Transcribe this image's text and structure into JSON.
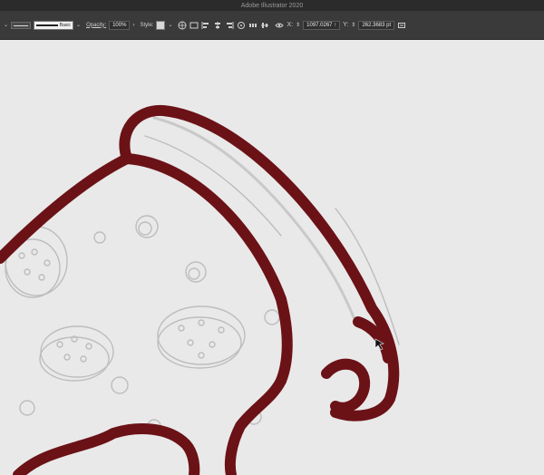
{
  "window": {
    "title": "Adobe Illustrator 2020"
  },
  "control_bar": {
    "stroke_style": "Basic",
    "opacity_label": "Opacity:",
    "opacity_value": "100%",
    "style_label": "Style:",
    "x_label": "X:",
    "x_value": "1097.0267 ↑",
    "y_label": "Y:",
    "y_value": "262.3683 pt"
  },
  "canvas": {
    "stroke_color": "#6b1217",
    "sketch_color": "#bdbdbd"
  }
}
